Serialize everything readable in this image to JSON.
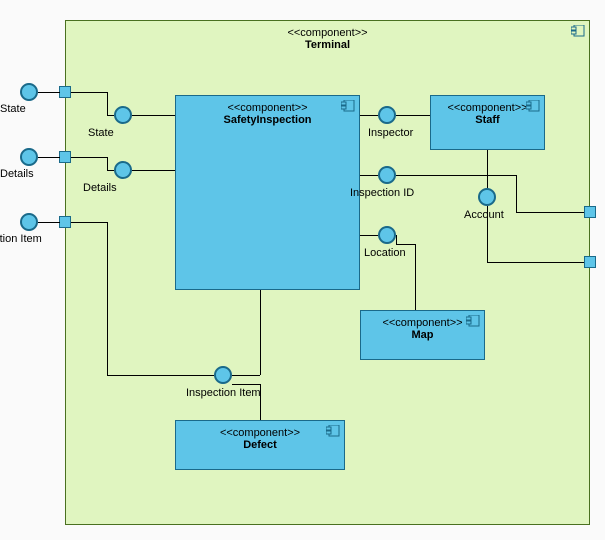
{
  "stereotype": "<<component>>",
  "container": {
    "name": "Terminal"
  },
  "components": {
    "safety": {
      "name": "SafetyInspection"
    },
    "staff": {
      "name": "Staff"
    },
    "map": {
      "name": "Map"
    },
    "defect": {
      "name": "Defect"
    }
  },
  "interfaces": {
    "state_ext": "State",
    "state_int": "State",
    "details_ext": "Details",
    "details_int": "Details",
    "item_ext": "ection Item",
    "item_int": "Inspection Item",
    "inspector": "Inspector",
    "inspection_id": "Inspection ID",
    "location": "Location",
    "account": "Account"
  }
}
